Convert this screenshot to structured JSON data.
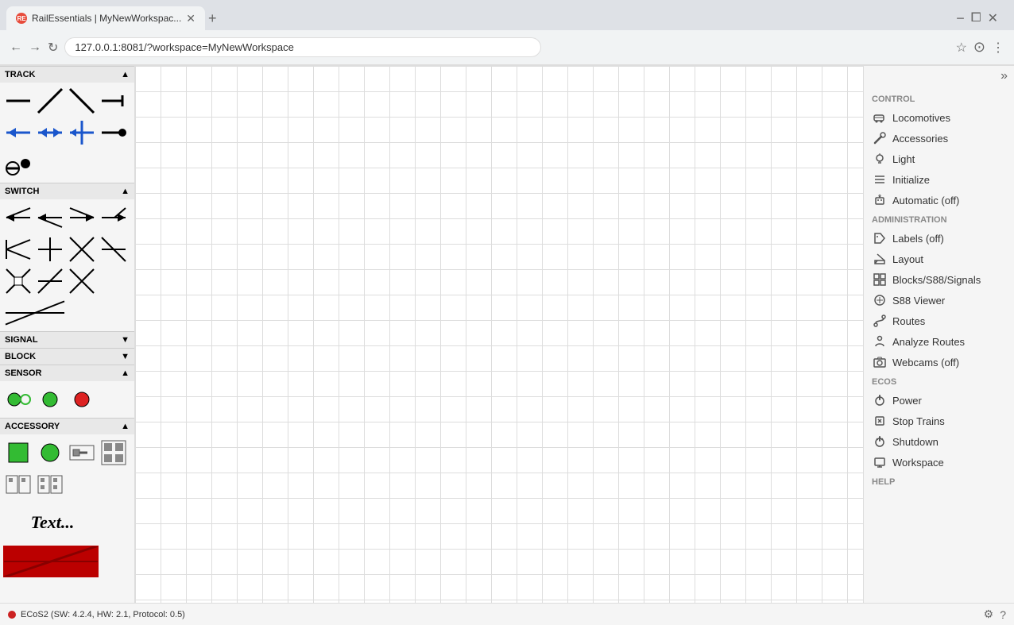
{
  "browser": {
    "tab_title": "RailEssentials | MyNewWorkspac...",
    "tab_favicon": "RE",
    "new_tab_label": "+",
    "address": "127.0.0.1:8081/?workspace=MyNewWorkspace"
  },
  "left_panel": {
    "sections": [
      {
        "key": "track",
        "label": "TRACK",
        "collapsed": false
      },
      {
        "key": "switch",
        "label": "SWITCH",
        "collapsed": false
      },
      {
        "key": "signal",
        "label": "SIGNAL",
        "collapsed": true
      },
      {
        "key": "block",
        "label": "BLOCK",
        "collapsed": true
      },
      {
        "key": "sensor",
        "label": "SENSOR",
        "collapsed": false
      },
      {
        "key": "accessory",
        "label": "ACCESSORY",
        "collapsed": false
      }
    ],
    "text_item_label": "Text...",
    "section_collapse_icon": "▼",
    "section_expand_icon": "▼"
  },
  "right_panel": {
    "collapse_btn": "»",
    "control_section_label": "CONTROL",
    "items_control": [
      {
        "key": "locomotives",
        "label": "Locomotives",
        "icon": "train"
      },
      {
        "key": "accessories",
        "label": "Accessories",
        "icon": "wrench"
      },
      {
        "key": "light",
        "label": "Light",
        "icon": "bulb"
      },
      {
        "key": "initialize",
        "label": "Initialize",
        "icon": "list"
      },
      {
        "key": "automatic",
        "label": "Automatic (off)",
        "icon": "robot"
      }
    ],
    "admin_section_label": "ADMINISTRATION",
    "items_admin": [
      {
        "key": "labels",
        "label": "Labels (off)",
        "icon": "tag"
      },
      {
        "key": "layout",
        "label": "Layout",
        "icon": "edit"
      },
      {
        "key": "blocks",
        "label": "Blocks/S88/Signals",
        "icon": "blocks"
      },
      {
        "key": "s88viewer",
        "label": "S88 Viewer",
        "icon": "circle"
      },
      {
        "key": "routes",
        "label": "Routes",
        "icon": "route"
      },
      {
        "key": "analyze",
        "label": "Analyze Routes",
        "icon": "person"
      },
      {
        "key": "webcams",
        "label": "Webcams (off)",
        "icon": "camera"
      }
    ],
    "ecos_section_label": "ECOS",
    "items_ecos": [
      {
        "key": "power",
        "label": "Power",
        "icon": "power"
      },
      {
        "key": "stop",
        "label": "Stop Trains",
        "icon": "stop"
      },
      {
        "key": "shutdown",
        "label": "Shutdown",
        "icon": "shutdown"
      },
      {
        "key": "workspace",
        "label": "Workspace",
        "icon": "workspace"
      }
    ],
    "help_section_label": "HELP"
  },
  "status_bar": {
    "text": "ECoS2 (SW: 4.2.4, HW: 2.1, Protocol: 0.5)",
    "dot_color": "#cc2222"
  }
}
